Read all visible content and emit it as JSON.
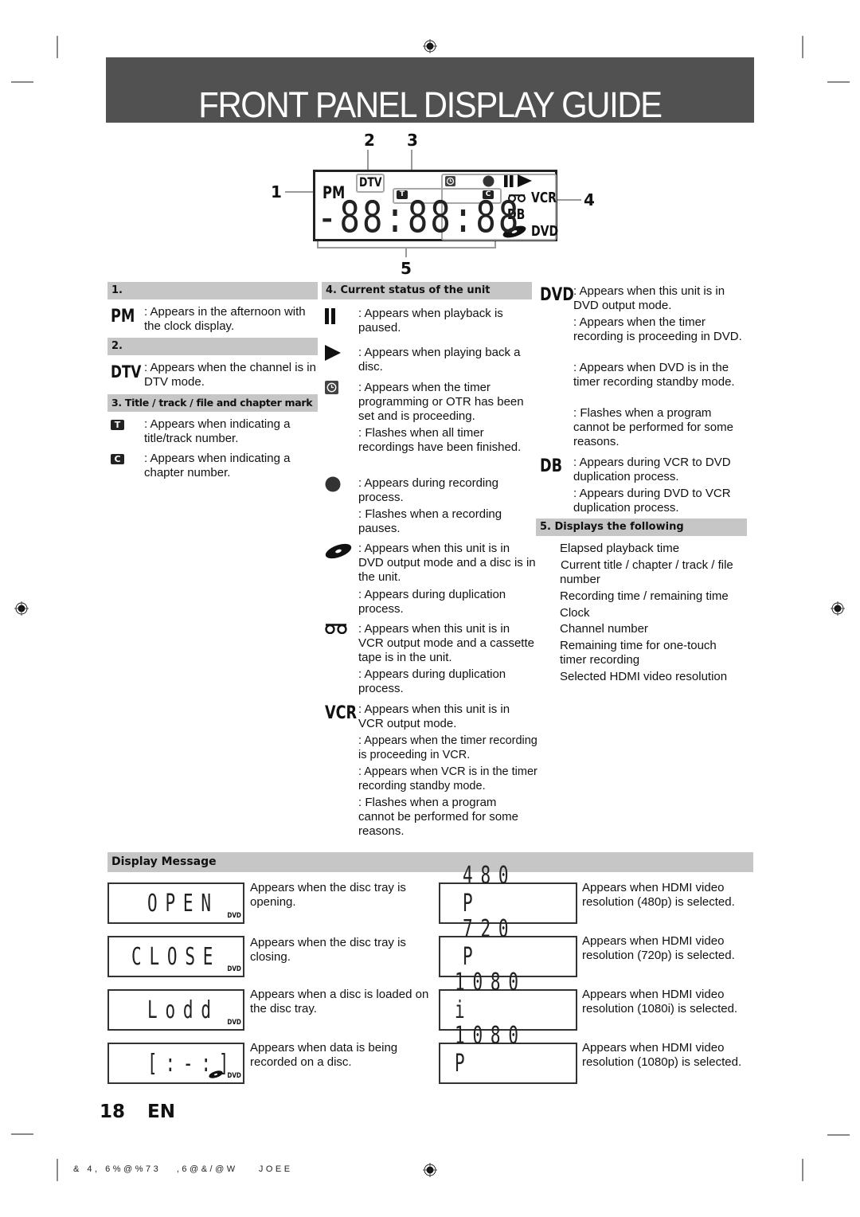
{
  "page": {
    "title": "FRONT PANEL DISPLAY GUIDE",
    "page_number": "18",
    "language": "EN",
    "footer_code": "& 4, 6%@%73   ,6@&/@W    JOEE",
    "banner_color": "#515151",
    "header_gray": "#c6c6c6"
  },
  "diagram": {
    "callouts": [
      "1",
      "2",
      "3",
      "4",
      "5"
    ],
    "lcd": {
      "pm": "PM",
      "dtv": "DTV",
      "title_mark": "T",
      "chapter_mark": "C",
      "digits": "-88:88:88",
      "vcr": "VCR",
      "db": "DB",
      "dvd": "DVD",
      "icons": [
        "clock-icon",
        "record-icon",
        "pause-icon",
        "play-icon",
        "cassette-icon",
        "disc-icon"
      ]
    }
  },
  "sections": {
    "s1": {
      "header": "1.",
      "items": [
        {
          "symbol": "PM",
          "lines": [
            ": Appears in the afternoon with the clock display."
          ]
        }
      ]
    },
    "s2": {
      "header": "2.",
      "items": [
        {
          "symbol": "DTV",
          "lines": [
            ": Appears when the channel is in DTV mode."
          ]
        }
      ]
    },
    "s3": {
      "header": "3. Title / track / file and chapter mark",
      "items": [
        {
          "symbol": "T",
          "lines": [
            ": Appears when indicating a title/track number."
          ]
        },
        {
          "symbol": "C",
          "lines": [
            ": Appears when indicating a chapter number."
          ]
        }
      ]
    },
    "s4": {
      "header": "4. Current status of the unit",
      "items": [
        {
          "symbol": "pause-icon",
          "lines": [
            ": Appears when playback is paused."
          ]
        },
        {
          "symbol": "play-icon",
          "lines": [
            ": Appears when playing back a disc."
          ]
        },
        {
          "symbol": "clock-icon",
          "lines": [
            ": Appears when the timer programming or OTR has been set and is proceeding.",
            ": Flashes when all timer recordings have been finished."
          ]
        },
        {
          "symbol": "record-icon",
          "lines": [
            ": Appears during recording process.",
            ": Flashes when a recording pauses."
          ]
        },
        {
          "symbol": "disc-icon",
          "lines": [
            ": Appears when this unit is in DVD output mode and a disc is in the unit.",
            ": Appears during duplication process."
          ]
        },
        {
          "symbol": "cassette-icon",
          "lines": [
            ": Appears when this unit is in VCR output mode and a cassette tape is in the unit.",
            ": Appears during duplication process."
          ]
        },
        {
          "symbol": "VCR",
          "lines": [
            ": Appears when this unit is in VCR output mode.",
            ": Appears when the timer recording is proceeding in VCR.",
            ": Appears when VCR is in the timer recording standby mode.",
            ": Flashes when a program cannot be performed for some reasons."
          ]
        },
        {
          "symbol": "DVD",
          "lines": [
            ": Appears when this unit is in DVD output mode.",
            ": Appears when the timer recording is proceeding in DVD.",
            ": Appears when DVD is in the timer recording standby mode.",
            ": Flashes when a program cannot be performed for some reasons."
          ]
        },
        {
          "symbol": "DB",
          "lines": [
            ": Appears during VCR to DVD duplication process.",
            ": Appears during DVD to VCR duplication process."
          ]
        }
      ]
    },
    "s5": {
      "header": "5. Displays the following",
      "items": [
        "Elapsed playback time",
        "Current title / chapter / track / file number",
        "Recording time / remaining time",
        "Clock",
        "Channel number",
        "Remaining time for one-touch timer recording",
        "Selected HDMI video resolution"
      ]
    }
  },
  "display_message": {
    "header": "Display Message",
    "left": [
      {
        "display": "OPEN",
        "indicator": "DVD",
        "text": "Appears when the disc tray is opening."
      },
      {
        "display": "CLOSE",
        "indicator": "DVD",
        "text": "Appears when the disc tray is closing."
      },
      {
        "display": "Lodd",
        "indicator": "DVD",
        "text": "Appears when a disc is loaded on the disc tray."
      },
      {
        "display": "[:-:]",
        "indicator": "DVD",
        "text": "Appears when data is being recorded on a disc."
      }
    ],
    "right": [
      {
        "display": "480 P",
        "text": "Appears when HDMI video resolution (480p) is selected."
      },
      {
        "display": "720 P",
        "text": "Appears when HDMI video resolution (720p) is selected."
      },
      {
        "display": "1080 i",
        "text": "Appears when HDMI video resolution (1080i) is selected."
      },
      {
        "display": "1080 P",
        "text": "Appears when HDMI video resolution (1080p) is selected."
      }
    ]
  }
}
